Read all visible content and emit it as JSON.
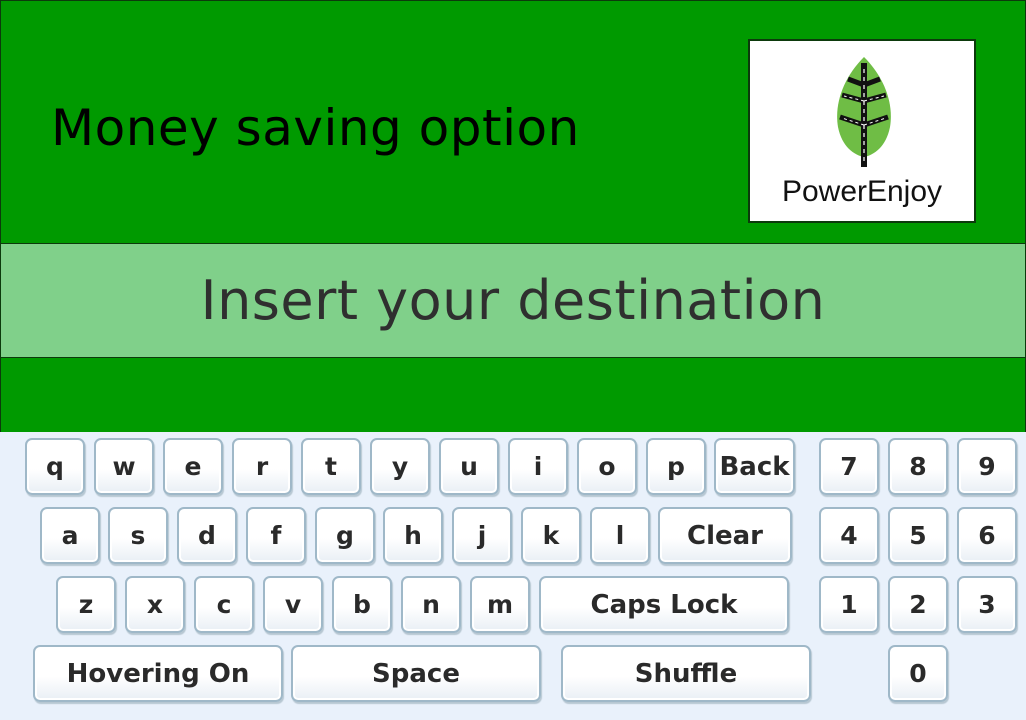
{
  "header": {
    "title": "Money saving option"
  },
  "logo": {
    "brand": "PowerEnjoy",
    "icon": "leaf-road-icon",
    "leaf_color": "#6fbd45",
    "road_color": "#000000"
  },
  "destination": {
    "prompt": "Insert your destination"
  },
  "keyboard": {
    "rows": [
      [
        "q",
        "w",
        "e",
        "r",
        "t",
        "y",
        "u",
        "i",
        "o",
        "p",
        "Back"
      ],
      [
        "a",
        "s",
        "d",
        "f",
        "g",
        "h",
        "j",
        "k",
        "l",
        "Clear"
      ],
      [
        "z",
        "x",
        "c",
        "v",
        "b",
        "n",
        "m",
        "Caps Lock"
      ],
      [
        "Hovering On",
        "Space",
        "Shuffle"
      ]
    ],
    "numpad": [
      [
        "7",
        "8",
        "9"
      ],
      [
        "4",
        "5",
        "6"
      ],
      [
        "1",
        "2",
        "3"
      ],
      [
        "0"
      ]
    ]
  },
  "colors": {
    "accent": "#009a00",
    "bar": "#80d08a",
    "keyboard_bg": "#e9f1fb",
    "key_border": "#9fb8c8"
  }
}
